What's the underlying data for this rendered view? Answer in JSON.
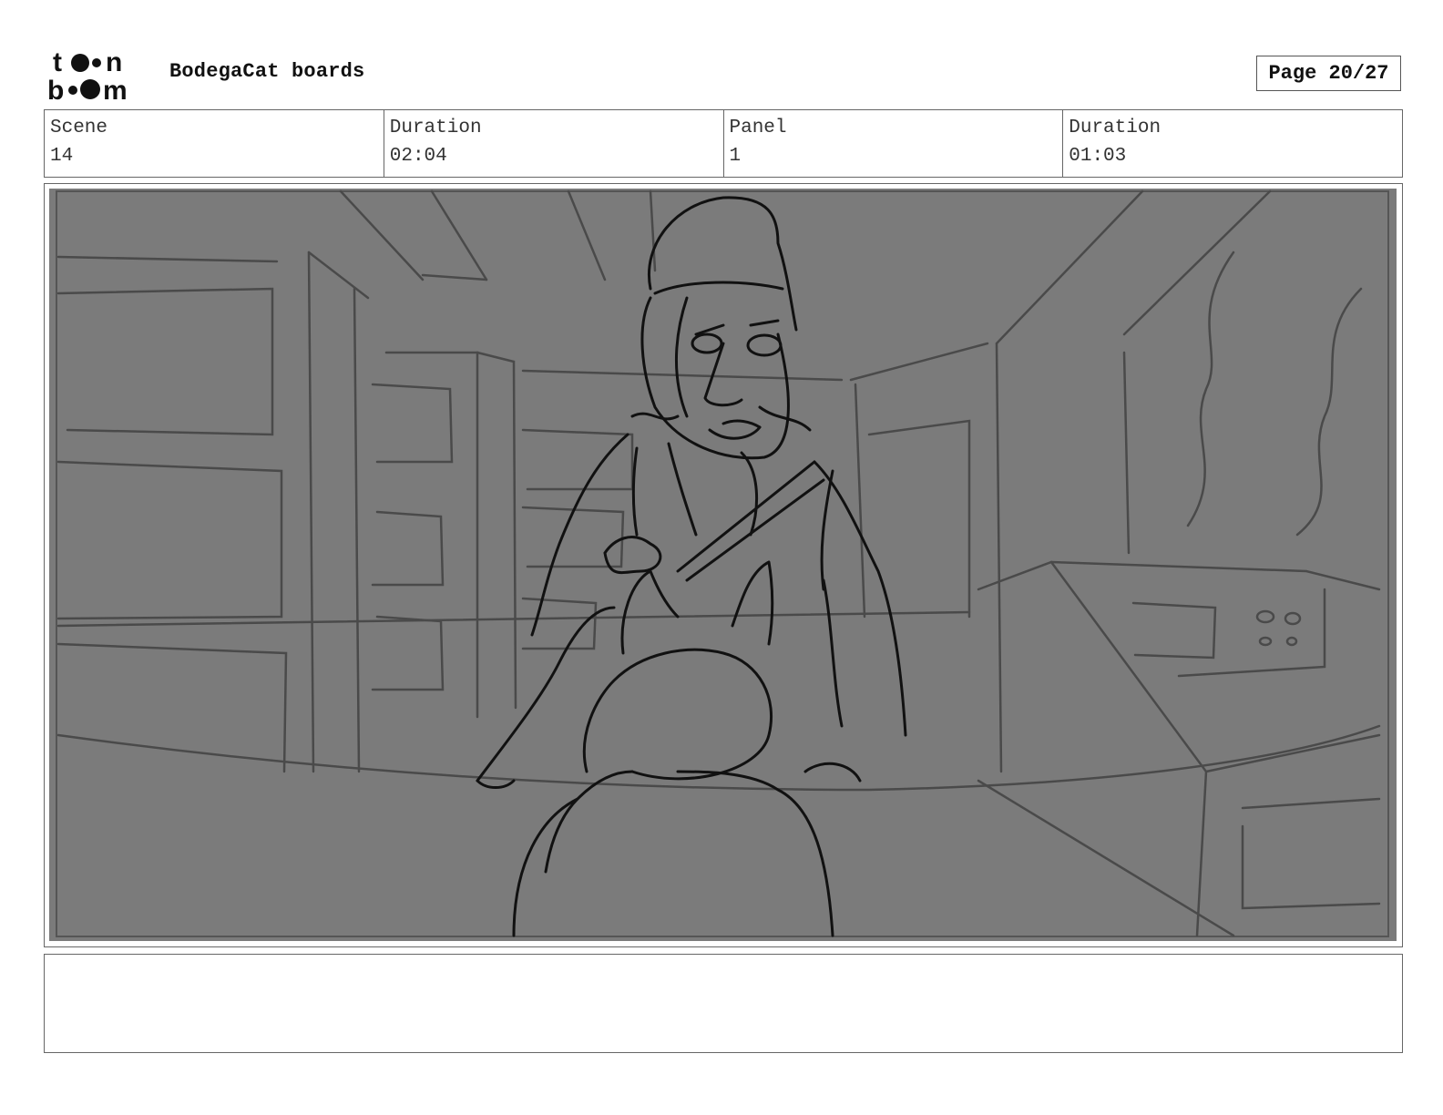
{
  "header": {
    "logo_text_line1": "toon",
    "logo_text_line2": "boom",
    "project_title": "BodegaCat boards",
    "page_label": "Page 20/27"
  },
  "info": [
    {
      "label": "Scene",
      "value": "14"
    },
    {
      "label": "Duration",
      "value": "02:04"
    },
    {
      "label": "Panel",
      "value": "1"
    },
    {
      "label": "Duration",
      "value": "01:03"
    }
  ],
  "panel": {
    "background_color": "#7b7b7b",
    "sketch_color": "#111111",
    "background_line_color": "#4a4a4a"
  },
  "caption": {
    "text": ""
  }
}
